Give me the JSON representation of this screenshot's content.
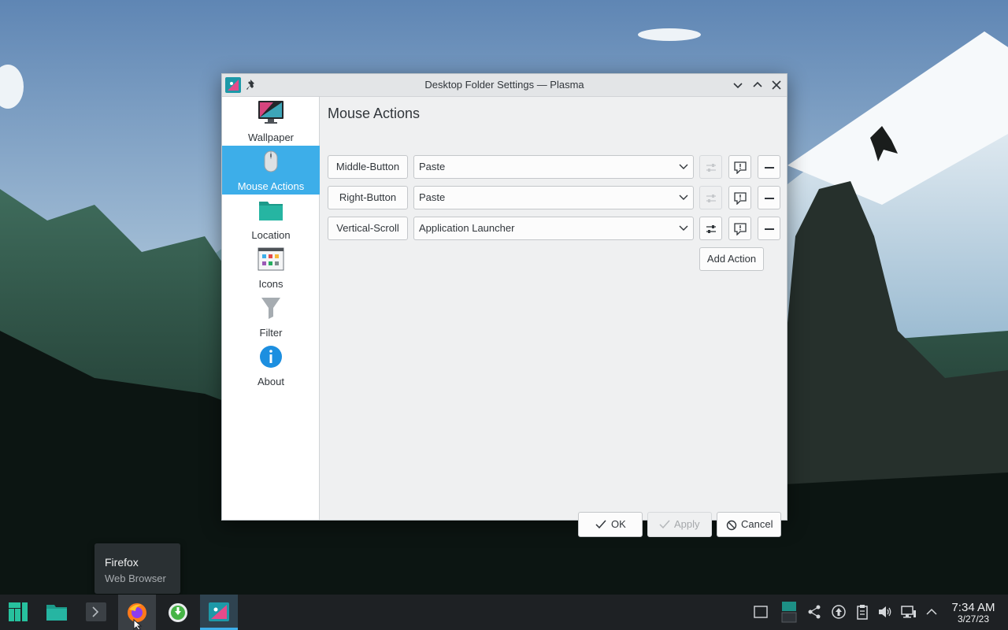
{
  "window": {
    "title": "Desktop Folder Settings — Plasma"
  },
  "sidebar": {
    "items": [
      {
        "label": "Wallpaper",
        "icon": "monitor-icon",
        "active": false
      },
      {
        "label": "Mouse Actions",
        "icon": "mouse-icon",
        "active": true
      },
      {
        "label": "Location",
        "icon": "folder-icon",
        "active": false
      },
      {
        "label": "Icons",
        "icon": "icons-view-icon",
        "active": false
      },
      {
        "label": "Filter",
        "icon": "funnel-icon",
        "active": false
      },
      {
        "label": "About",
        "icon": "info-icon",
        "active": false
      }
    ]
  },
  "main": {
    "heading": "Mouse Actions",
    "actions": [
      {
        "trigger": "Middle-Button",
        "plugin": "Paste",
        "configurable": false
      },
      {
        "trigger": "Right-Button",
        "plugin": "Paste",
        "configurable": false
      },
      {
        "trigger": "Vertical-Scroll",
        "plugin": "Application Launcher",
        "configurable": true
      }
    ],
    "add_action_label": "Add Action"
  },
  "footer": {
    "ok_label": "OK",
    "apply_label": "Apply",
    "cancel_label": "Cancel"
  },
  "tooltip": {
    "title": "Firefox",
    "subtitle": "Web Browser"
  },
  "taskbar": {
    "items": [
      "manjaro-menu-icon",
      "file-manager-icon",
      "terminal-icon",
      "firefox-icon",
      "software-update-icon",
      "plasma-settings-icon"
    ],
    "tray": [
      "show-desktop-icon",
      "pager-icon",
      "network-share-icon",
      "updates-icon",
      "clipboard-icon",
      "volume-icon",
      "network-icon",
      "expand-tray-icon"
    ],
    "time": "7:34 AM",
    "date": "3/27/23"
  },
  "colors": {
    "accent": "#3daee9",
    "window_bg": "#eff0f1",
    "taskbar_bg": "#1e2124"
  }
}
